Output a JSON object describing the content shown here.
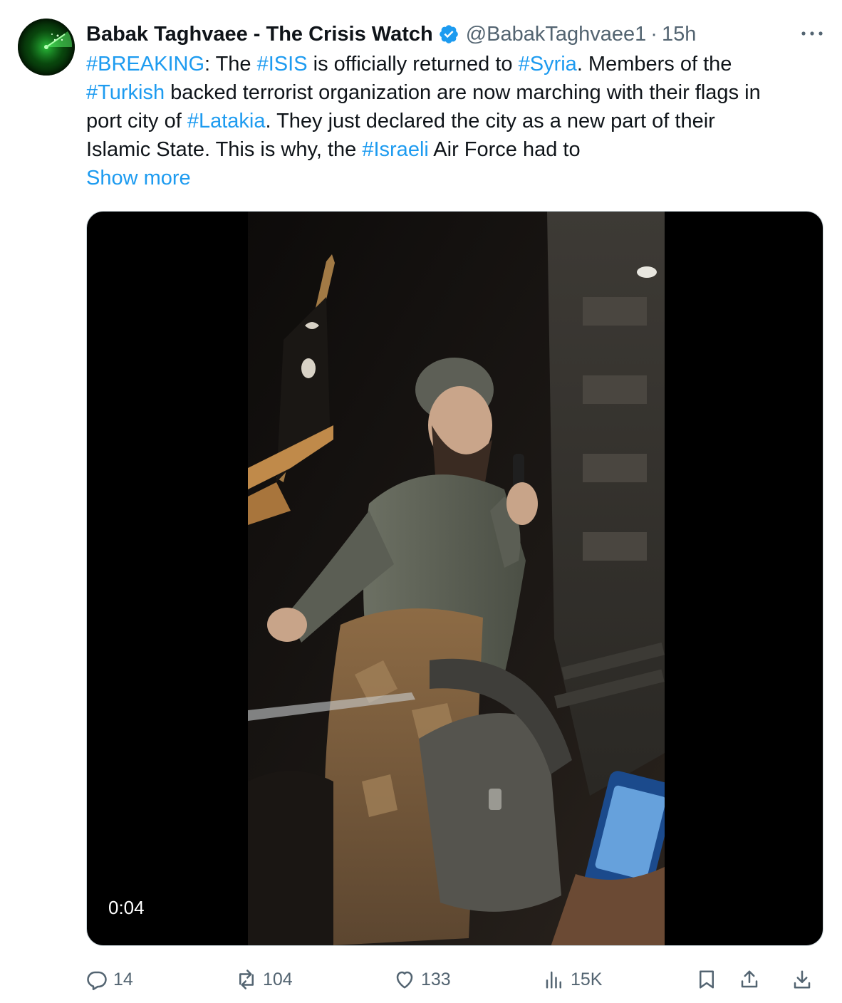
{
  "author": {
    "display_name": "Babak Taghvaee - The Crisis Watch",
    "handle": "@BabakTaghvaee1",
    "separator": "·",
    "timestamp": "15h",
    "verified": true
  },
  "tweet": {
    "lines": [
      [
        {
          "text": "#BREAKING",
          "tag": true
        },
        {
          "text": ": The ",
          "tag": false
        },
        {
          "text": "#ISIS",
          "tag": true
        },
        {
          "text": " is officially returned to ",
          "tag": false
        },
        {
          "text": "#Syria",
          "tag": true
        },
        {
          "text": ". Members of the",
          "tag": false
        }
      ],
      [
        {
          "text": "#Turkish",
          "tag": true
        },
        {
          "text": " backed terrorist organization are now marching with their flags in",
          "tag": false
        }
      ],
      [
        {
          "text": "port city of ",
          "tag": false
        },
        {
          "text": "#Latakia",
          "tag": true
        },
        {
          "text": ". They just declared the city as a new part of their",
          "tag": false
        }
      ],
      [
        {
          "text": "Islamic State. This is why, the ",
          "tag": false
        },
        {
          "text": "#Israeli",
          "tag": true
        },
        {
          "text": " Air Force had to",
          "tag": false
        }
      ]
    ],
    "show_more": "Show more"
  },
  "media": {
    "duration": "0:04"
  },
  "actions": {
    "replies": "14",
    "reposts": "104",
    "likes": "133",
    "views": "15K"
  },
  "colors": {
    "accent": "#1d9bf0",
    "secondary_text": "#536471",
    "primary_text": "#0f1419"
  },
  "icons": {
    "more": "more-horizontal-icon",
    "verified": "verified-badge-icon",
    "reply": "reply-icon",
    "repost": "repost-icon",
    "like": "heart-icon",
    "views": "views-chart-icon",
    "bookmark": "bookmark-icon",
    "share": "share-icon",
    "download": "download-icon"
  }
}
